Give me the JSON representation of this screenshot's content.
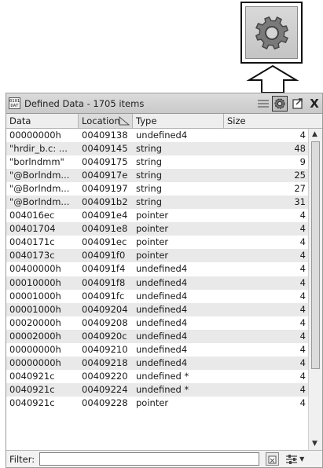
{
  "window": {
    "icon_label": "0101 DAT",
    "title": "Defined Data - 1705 items",
    "close_label": "X"
  },
  "columns": [
    "Data",
    "Location",
    "Type",
    "Size"
  ],
  "rows": [
    {
      "data": "00000000h",
      "location": "00409138",
      "type": "undefined4",
      "size": "4"
    },
    {
      "data": "\"hrdir_b.c: ...",
      "location": "00409145",
      "type": "string",
      "size": "48"
    },
    {
      "data": "\"borlndmm\"",
      "location": "00409175",
      "type": "string",
      "size": "9"
    },
    {
      "data": "\"@Borlndm...",
      "location": "0040917e",
      "type": "string",
      "size": "25"
    },
    {
      "data": "\"@Borlndm...",
      "location": "00409197",
      "type": "string",
      "size": "27"
    },
    {
      "data": "\"@Borlndm...",
      "location": "004091b2",
      "type": "string",
      "size": "31"
    },
    {
      "data": "004016ec",
      "location": "004091e4",
      "type": "pointer",
      "size": "4"
    },
    {
      "data": "00401704",
      "location": "004091e8",
      "type": "pointer",
      "size": "4"
    },
    {
      "data": "0040171c",
      "location": "004091ec",
      "type": "pointer",
      "size": "4"
    },
    {
      "data": "0040173c",
      "location": "004091f0",
      "type": "pointer",
      "size": "4"
    },
    {
      "data": "00400000h",
      "location": "004091f4",
      "type": "undefined4",
      "size": "4"
    },
    {
      "data": "00010000h",
      "location": "004091f8",
      "type": "undefined4",
      "size": "4"
    },
    {
      "data": "00001000h",
      "location": "004091fc",
      "type": "undefined4",
      "size": "4"
    },
    {
      "data": "00001000h",
      "location": "00409204",
      "type": "undefined4",
      "size": "4"
    },
    {
      "data": "00020000h",
      "location": "00409208",
      "type": "undefined4",
      "size": "4"
    },
    {
      "data": "00002000h",
      "location": "0040920c",
      "type": "undefined4",
      "size": "4"
    },
    {
      "data": "00000000h",
      "location": "00409210",
      "type": "undefined4",
      "size": "4"
    },
    {
      "data": "00000000h",
      "location": "00409218",
      "type": "undefined4",
      "size": "4"
    },
    {
      "data": "0040921c",
      "location": "00409220",
      "type": "undefined *",
      "size": "4"
    },
    {
      "data": "0040921c",
      "location": "00409224",
      "type": "undefined *",
      "size": "4"
    },
    {
      "data": "0040921c",
      "location": "00409228",
      "type": "pointer",
      "size": "4"
    }
  ],
  "filter": {
    "label": "Filter:",
    "value": ""
  },
  "icons": {
    "callout": "gear-icon",
    "toolbar": [
      "lines-icon",
      "gear-icon",
      "export-icon",
      "close-icon"
    ],
    "filter": [
      "clear-filter-icon",
      "filter-options-icon"
    ]
  },
  "colors": {
    "row_alt": "#e9e9e9",
    "titlebar": "#d2d2d2",
    "header": "#eeeeee"
  }
}
